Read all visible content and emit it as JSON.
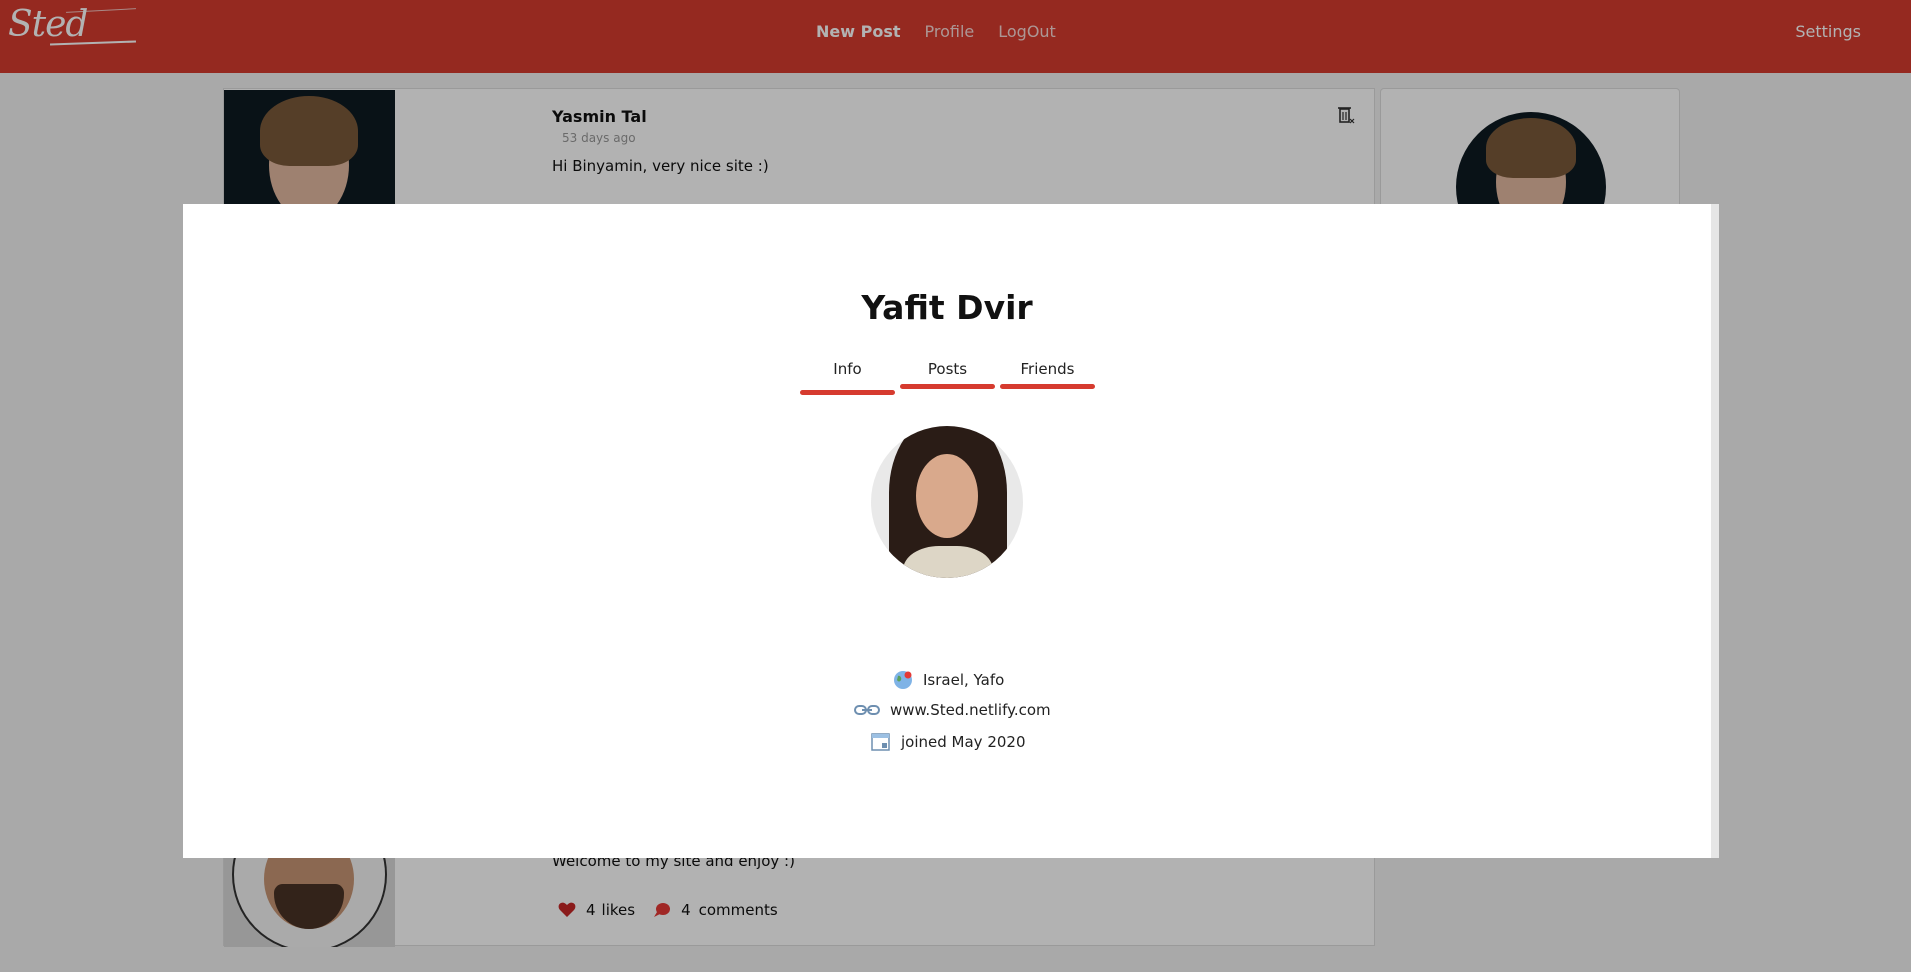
{
  "navbar": {
    "logo_text": "Sted",
    "links": [
      "New Post",
      "Profile",
      "LogOut"
    ],
    "settings": "Settings",
    "brand_color": "#d63b2f"
  },
  "feed": {
    "post1": {
      "author": "Yasmin Tal",
      "time": "53 days ago",
      "text": "Hi Binyamin, very nice site :)"
    },
    "post2": {
      "text": "Welcome to my site and enjoy :)",
      "likes_count": "4",
      "likes_label": "likes",
      "comments_count": "4",
      "comments_label": "comments"
    }
  },
  "modal": {
    "name": "Yafit Dvir",
    "tabs": [
      "Info",
      "Posts",
      "Friends"
    ],
    "active_tab": "Info",
    "location": "Israel, Yafo",
    "website": "www.Sted.netlify.com",
    "joined": "joined May 2020"
  },
  "icons": [
    "delete-icon",
    "heart-icon",
    "comment-icon",
    "globe-icon",
    "link-icon",
    "calendar-icon"
  ]
}
